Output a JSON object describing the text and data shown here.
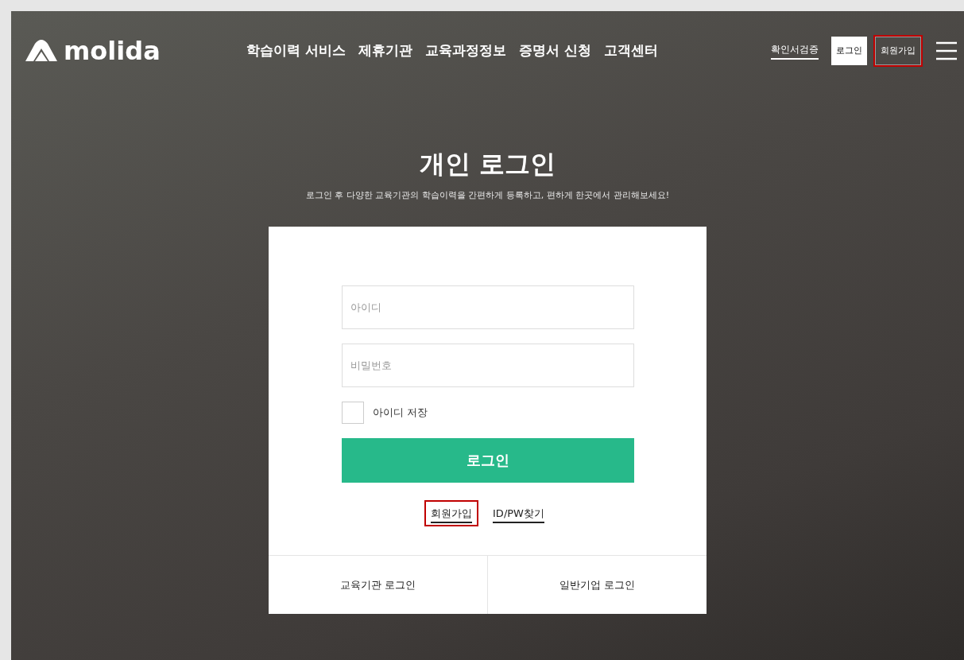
{
  "logo": {
    "text": "molida"
  },
  "nav": [
    {
      "label": "학습이력 서비스"
    },
    {
      "label": "제휴기관"
    },
    {
      "label": "교육과정정보"
    },
    {
      "label": "증명서 신청"
    },
    {
      "label": "고객센터"
    }
  ],
  "header_actions": [
    {
      "kind": "link",
      "label": "확인서검증",
      "highlighted": false
    },
    {
      "kind": "button",
      "label": "로그인",
      "highlighted": false
    },
    {
      "kind": "plain",
      "label": "회원가입",
      "highlighted": true
    }
  ],
  "title": "개인 로그인",
  "subtitle": "로그인 후 다양한 교육기관의 학습이력을 간편하게 등록하고, 편하게 한곳에서 관리해보세요!",
  "form": {
    "id_placeholder": "아이디",
    "pw_placeholder": "비밀번호",
    "remember": {
      "label": "아이디 저장",
      "checked": false
    },
    "submit": "로그인",
    "links": [
      {
        "label": "회원가입",
        "highlighted": true
      },
      {
        "label": "ID/PW찾기",
        "highlighted": false
      }
    ]
  },
  "bottom_tabs": [
    {
      "label": "교육기관 로그인"
    },
    {
      "label": "일반기업 로그인"
    }
  ]
}
